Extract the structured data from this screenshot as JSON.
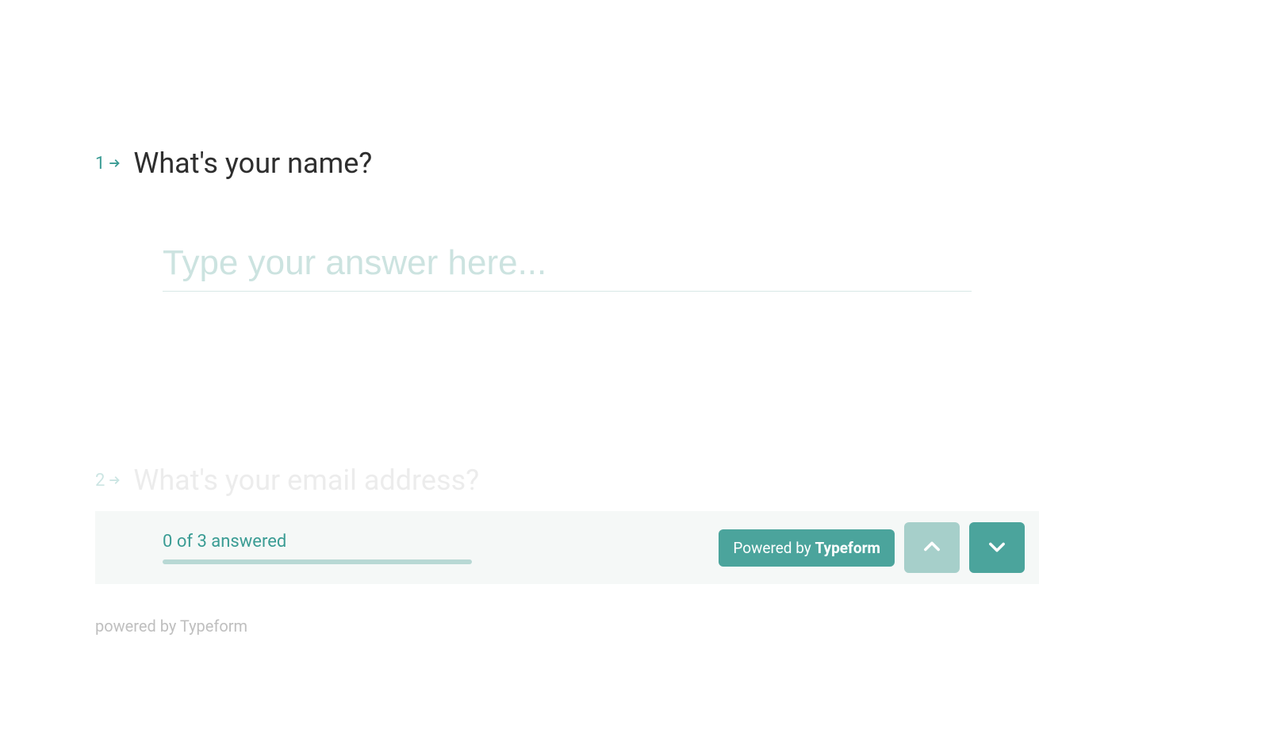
{
  "questions": [
    {
      "number": "1",
      "text": "What's your name?",
      "placeholder": "Type your answer here..."
    },
    {
      "number": "2",
      "text": "What's your email address?"
    }
  ],
  "footer": {
    "progress_text": "0 of 3 answered",
    "powered_prefix": "Powered by ",
    "powered_brand": "Typeform"
  },
  "bottom_credit": "powered by Typeform"
}
